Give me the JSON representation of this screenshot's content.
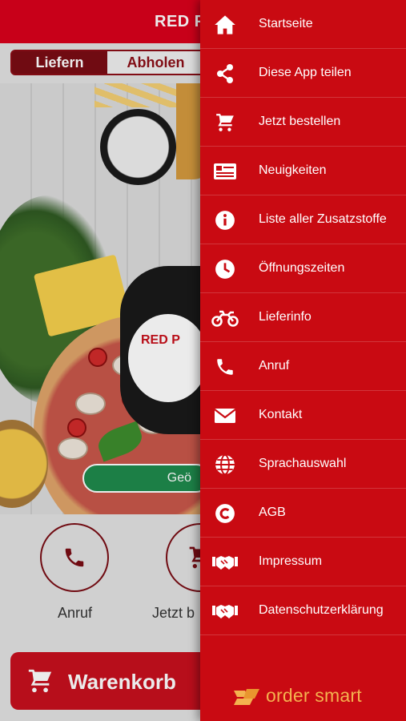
{
  "app": {
    "title_partial": "RED PI",
    "tabs": [
      {
        "label": "Liefern",
        "selected": true
      },
      {
        "label": "Abholen",
        "selected": false
      }
    ],
    "hero_logo_text": "RED P",
    "hero_pill_text": "Geö",
    "actions": [
      {
        "label": "Anruf",
        "icon": "phone-icon"
      },
      {
        "label": "Jetzt b",
        "icon": "cart-icon"
      }
    ],
    "cart_label": "Warenkorb"
  },
  "drawer": {
    "items": [
      {
        "label": "Startseite",
        "icon": "home-icon"
      },
      {
        "label": "Diese App teilen",
        "icon": "share-icon"
      },
      {
        "label": "Jetzt bestellen",
        "icon": "cart-icon"
      },
      {
        "label": "Neuigkeiten",
        "icon": "news-icon"
      },
      {
        "label": "Liste aller Zusatzstoffe",
        "icon": "info-icon"
      },
      {
        "label": "Öffnungszeiten",
        "icon": "clock-icon"
      },
      {
        "label": "Lieferinfo",
        "icon": "motorbike-icon"
      },
      {
        "label": "Anruf",
        "icon": "phone-icon"
      },
      {
        "label": "Kontakt",
        "icon": "mail-icon"
      },
      {
        "label": "Sprachauswahl",
        "icon": "globe-icon"
      },
      {
        "label": "AGB",
        "icon": "copyright-icon"
      },
      {
        "label": "Impressum",
        "icon": "handshake-icon"
      },
      {
        "label": "Datenschutzerklärung",
        "icon": "handshake-icon"
      }
    ],
    "brand": "order smart"
  },
  "colors": {
    "brand_red": "#c90a12",
    "dark_red": "#7a0d14",
    "brand_orange": "#f4b24f",
    "open_green": "#1f8a4c"
  }
}
